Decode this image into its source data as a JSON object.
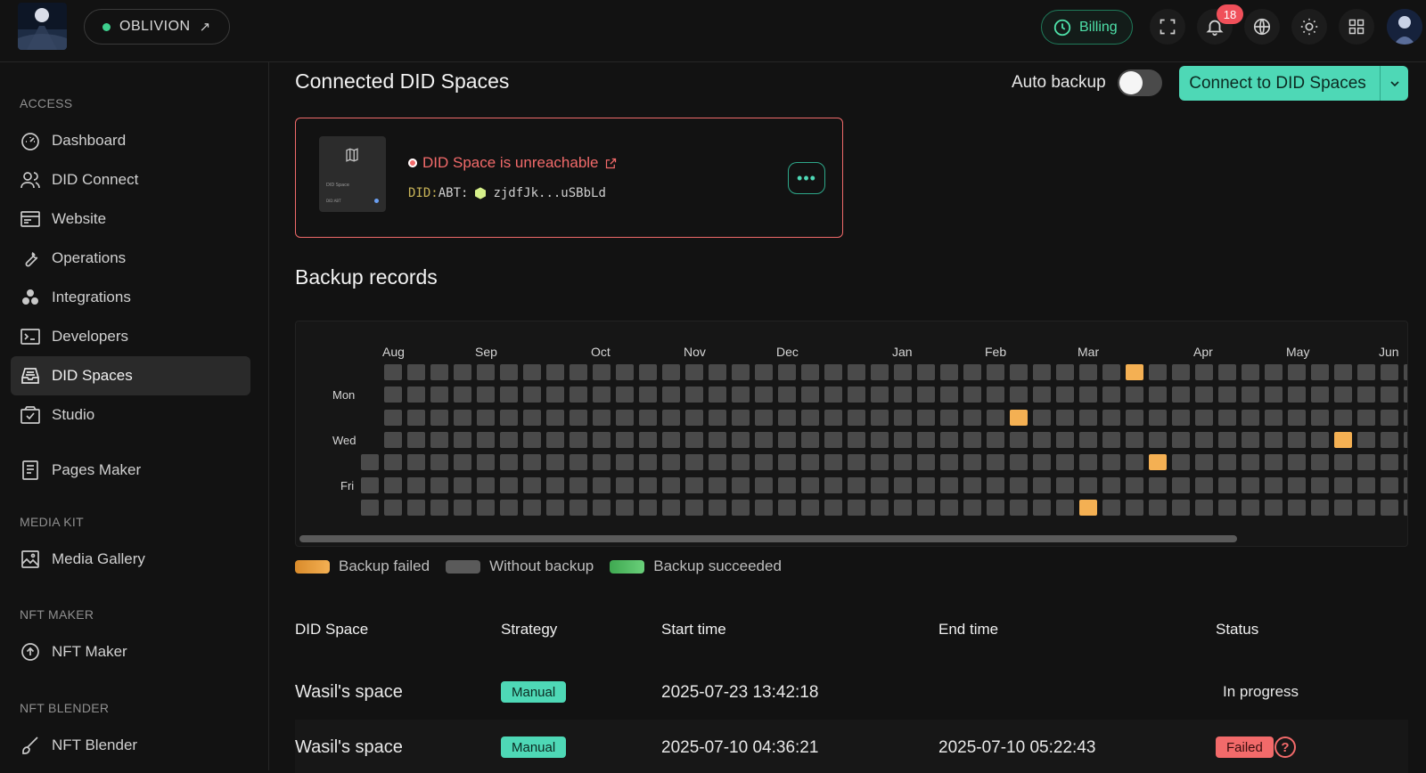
{
  "topbar": {
    "app_name": "OBLIVION",
    "billing_label": "Billing",
    "notification_count": "18"
  },
  "sidebar": {
    "sections": {
      "access": "ACCESS",
      "media_kit": "MEDIA KIT",
      "nft_maker": "NFT MAKER",
      "nft_blender": "NFT BLENDER"
    },
    "items": [
      {
        "label": "Dashboard",
        "icon": "dashboard-icon"
      },
      {
        "label": "DID Connect",
        "icon": "users-icon"
      },
      {
        "label": "Website",
        "icon": "browser-icon"
      },
      {
        "label": "Operations",
        "icon": "wrench-icon"
      },
      {
        "label": "Integrations",
        "icon": "integrations-icon"
      },
      {
        "label": "Developers",
        "icon": "terminal-icon"
      },
      {
        "label": "DID Spaces",
        "icon": "storage-icon",
        "active": true
      },
      {
        "label": "Studio",
        "icon": "studio-icon"
      },
      {
        "label": "Pages Maker",
        "icon": "pages-icon"
      },
      {
        "label": "Media Gallery",
        "icon": "gallery-icon"
      },
      {
        "label": "NFT Maker",
        "icon": "nft-maker-icon"
      },
      {
        "label": "NFT Blender",
        "icon": "brush-icon"
      }
    ]
  },
  "main": {
    "title": "Connected DID Spaces",
    "auto_backup_label": "Auto backup",
    "auto_backup_on": false,
    "connect_label": "Connect to DID Spaces",
    "space_card": {
      "status": "DID Space is unreachable",
      "did_prefix": "DID:",
      "did_chain": "ABT:",
      "did_value": "zjdfJk...uSBbLd",
      "thumb_label": "DID Space",
      "thumb_sub": "DID:ABT"
    },
    "backup_title": "Backup records",
    "heatmap": {
      "months": [
        "Aug",
        "Sep",
        "Oct",
        "Nov",
        "Dec",
        "Jan",
        "Feb",
        "Mar",
        "Apr",
        "May",
        "Jun"
      ],
      "weekday_labels": [
        "Mon",
        "Wed",
        "Fri"
      ],
      "failed_cells": [
        {
          "week": 33,
          "day": 0
        },
        {
          "week": 28,
          "day": 2
        },
        {
          "week": 42,
          "day": 3
        },
        {
          "week": 34,
          "day": 4
        },
        {
          "week": 31,
          "day": 6
        }
      ]
    },
    "legend": [
      {
        "label": "Backup failed",
        "color": "#f4b053"
      },
      {
        "label": "Without backup",
        "color": "#5a5a5a"
      },
      {
        "label": "Backup succeeded",
        "color": "#58c26a"
      }
    ],
    "table": {
      "headers": [
        "DID Space",
        "Strategy",
        "Start time",
        "End time",
        "Status"
      ],
      "rows": [
        {
          "space": "Wasil's space",
          "strategy": "Manual",
          "start": "2025-07-23 13:42:18",
          "end": "",
          "status": "In progress"
        },
        {
          "space": "Wasil's space",
          "strategy": "Manual",
          "start": "2025-07-10 04:36:21",
          "end": "2025-07-10 05:22:43",
          "status": "Failed"
        }
      ]
    }
  }
}
